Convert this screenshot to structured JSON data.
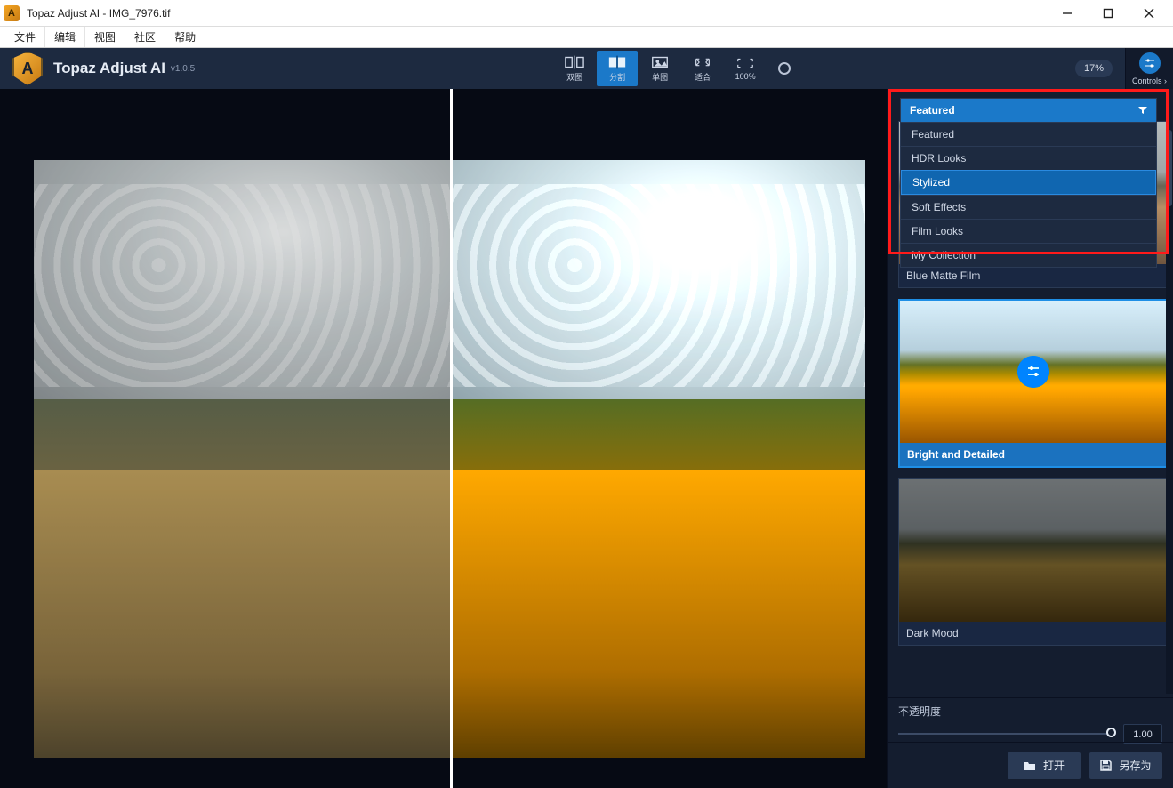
{
  "window": {
    "title": "Topaz Adjust AI - IMG_7976.tif"
  },
  "menu": {
    "file": "文件",
    "edit": "编辑",
    "view": "视图",
    "community": "社区",
    "help": "帮助"
  },
  "brand": {
    "name": "Topaz Adjust AI",
    "version": "v1.0.5"
  },
  "viewmodes": {
    "dual": "双图",
    "split": "分割",
    "single": "单图",
    "fit": "适合",
    "hundred": "100%"
  },
  "zoom": {
    "value": "17%"
  },
  "controls": {
    "label": "Controls"
  },
  "dropdown": {
    "selected": "Featured",
    "options": [
      "Featured",
      "HDR Looks",
      "Stylized",
      "Soft Effects",
      "Film Looks",
      "My Collection"
    ],
    "hovered": "Stylized"
  },
  "presets": [
    {
      "name": "Blue Matte Film",
      "variant": "matte",
      "selected": false
    },
    {
      "name": "Bright and Detailed",
      "variant": "hdr",
      "selected": true
    },
    {
      "name": "Dark Mood",
      "variant": "dark",
      "selected": false
    }
  ],
  "opacity": {
    "label": "不透明度",
    "value": "1.00"
  },
  "actions": {
    "open": "打开",
    "saveas": "另存为"
  }
}
